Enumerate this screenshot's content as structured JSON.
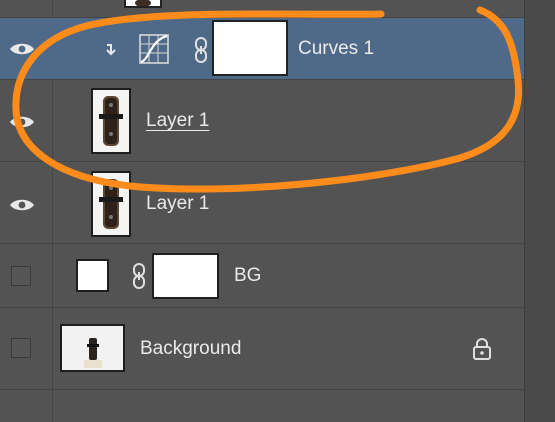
{
  "layers": [
    {
      "name": "Curves 1",
      "type": "adjustment",
      "visible": true,
      "selected": true,
      "clipped": true
    },
    {
      "name": "Layer 1",
      "type": "pixel",
      "visible": true,
      "selected": false,
      "underlined": true
    },
    {
      "name": "Layer 1",
      "type": "pixel",
      "visible": true,
      "selected": false
    },
    {
      "name": "BG",
      "type": "masked-fill",
      "visible": false,
      "selected": false
    },
    {
      "name": "Background",
      "type": "background",
      "visible": false,
      "selected": false,
      "locked": true
    }
  ],
  "colors": {
    "panel_bg": "#535353",
    "selected_bg": "#4f6a88",
    "annotation_stroke": "#ff8c1a"
  },
  "icons": [
    "eye-icon",
    "clip-arrow-icon",
    "curves-adjustment-icon",
    "link-chain-icon",
    "lock-icon"
  ]
}
